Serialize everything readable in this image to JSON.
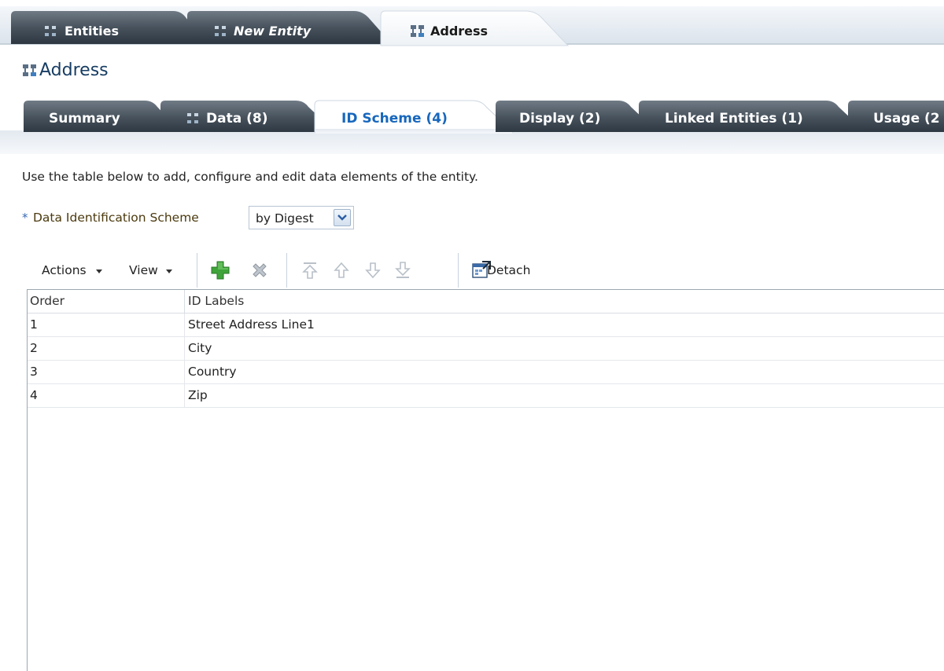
{
  "doc_tabs": [
    {
      "label": "Entities",
      "icon": "entity-icon",
      "active": false,
      "italic": false
    },
    {
      "label": "New Entity",
      "icon": "entity-icon",
      "active": false,
      "italic": true
    },
    {
      "label": "Address",
      "icon": "entity-group-icon",
      "active": true,
      "italic": false
    }
  ],
  "page": {
    "title": "Address",
    "title_icon": "entity-group-icon"
  },
  "sub_tabs": [
    {
      "label": "Summary",
      "active": false
    },
    {
      "label": "Data (8)",
      "active": false,
      "icon": "entity-icon"
    },
    {
      "label": "ID Scheme (4)",
      "active": true
    },
    {
      "label": "Display (2)",
      "active": false
    },
    {
      "label": "Linked Entities (1)",
      "active": false
    },
    {
      "label": "Usage (2",
      "active": false
    }
  ],
  "instructions": "Use the table below to add, configure and edit data elements of the entity.",
  "scheme": {
    "required_marker": "*",
    "label": "Data Identification Scheme",
    "value": "by Digest"
  },
  "toolbar": {
    "actions_label": "Actions",
    "view_label": "View",
    "detach_label": "Detach",
    "icons": [
      "add-icon",
      "delete-icon",
      "move-top-icon",
      "move-up-icon",
      "move-down-icon",
      "move-bottom-icon",
      "detach-icon"
    ]
  },
  "table": {
    "columns": [
      "Order",
      "ID Labels"
    ],
    "rows": [
      {
        "order": "1",
        "label": "Street Address Line1"
      },
      {
        "order": "2",
        "label": "City"
      },
      {
        "order": "3",
        "label": "Country"
      },
      {
        "order": "4",
        "label": "Zip"
      }
    ]
  },
  "colors": {
    "tab_dark": "#3c4956",
    "active_subtab_text": "#1767bd",
    "title_text": "#173d63",
    "add_green": "#3fa43a",
    "required_blue": "#3b6ab4"
  }
}
